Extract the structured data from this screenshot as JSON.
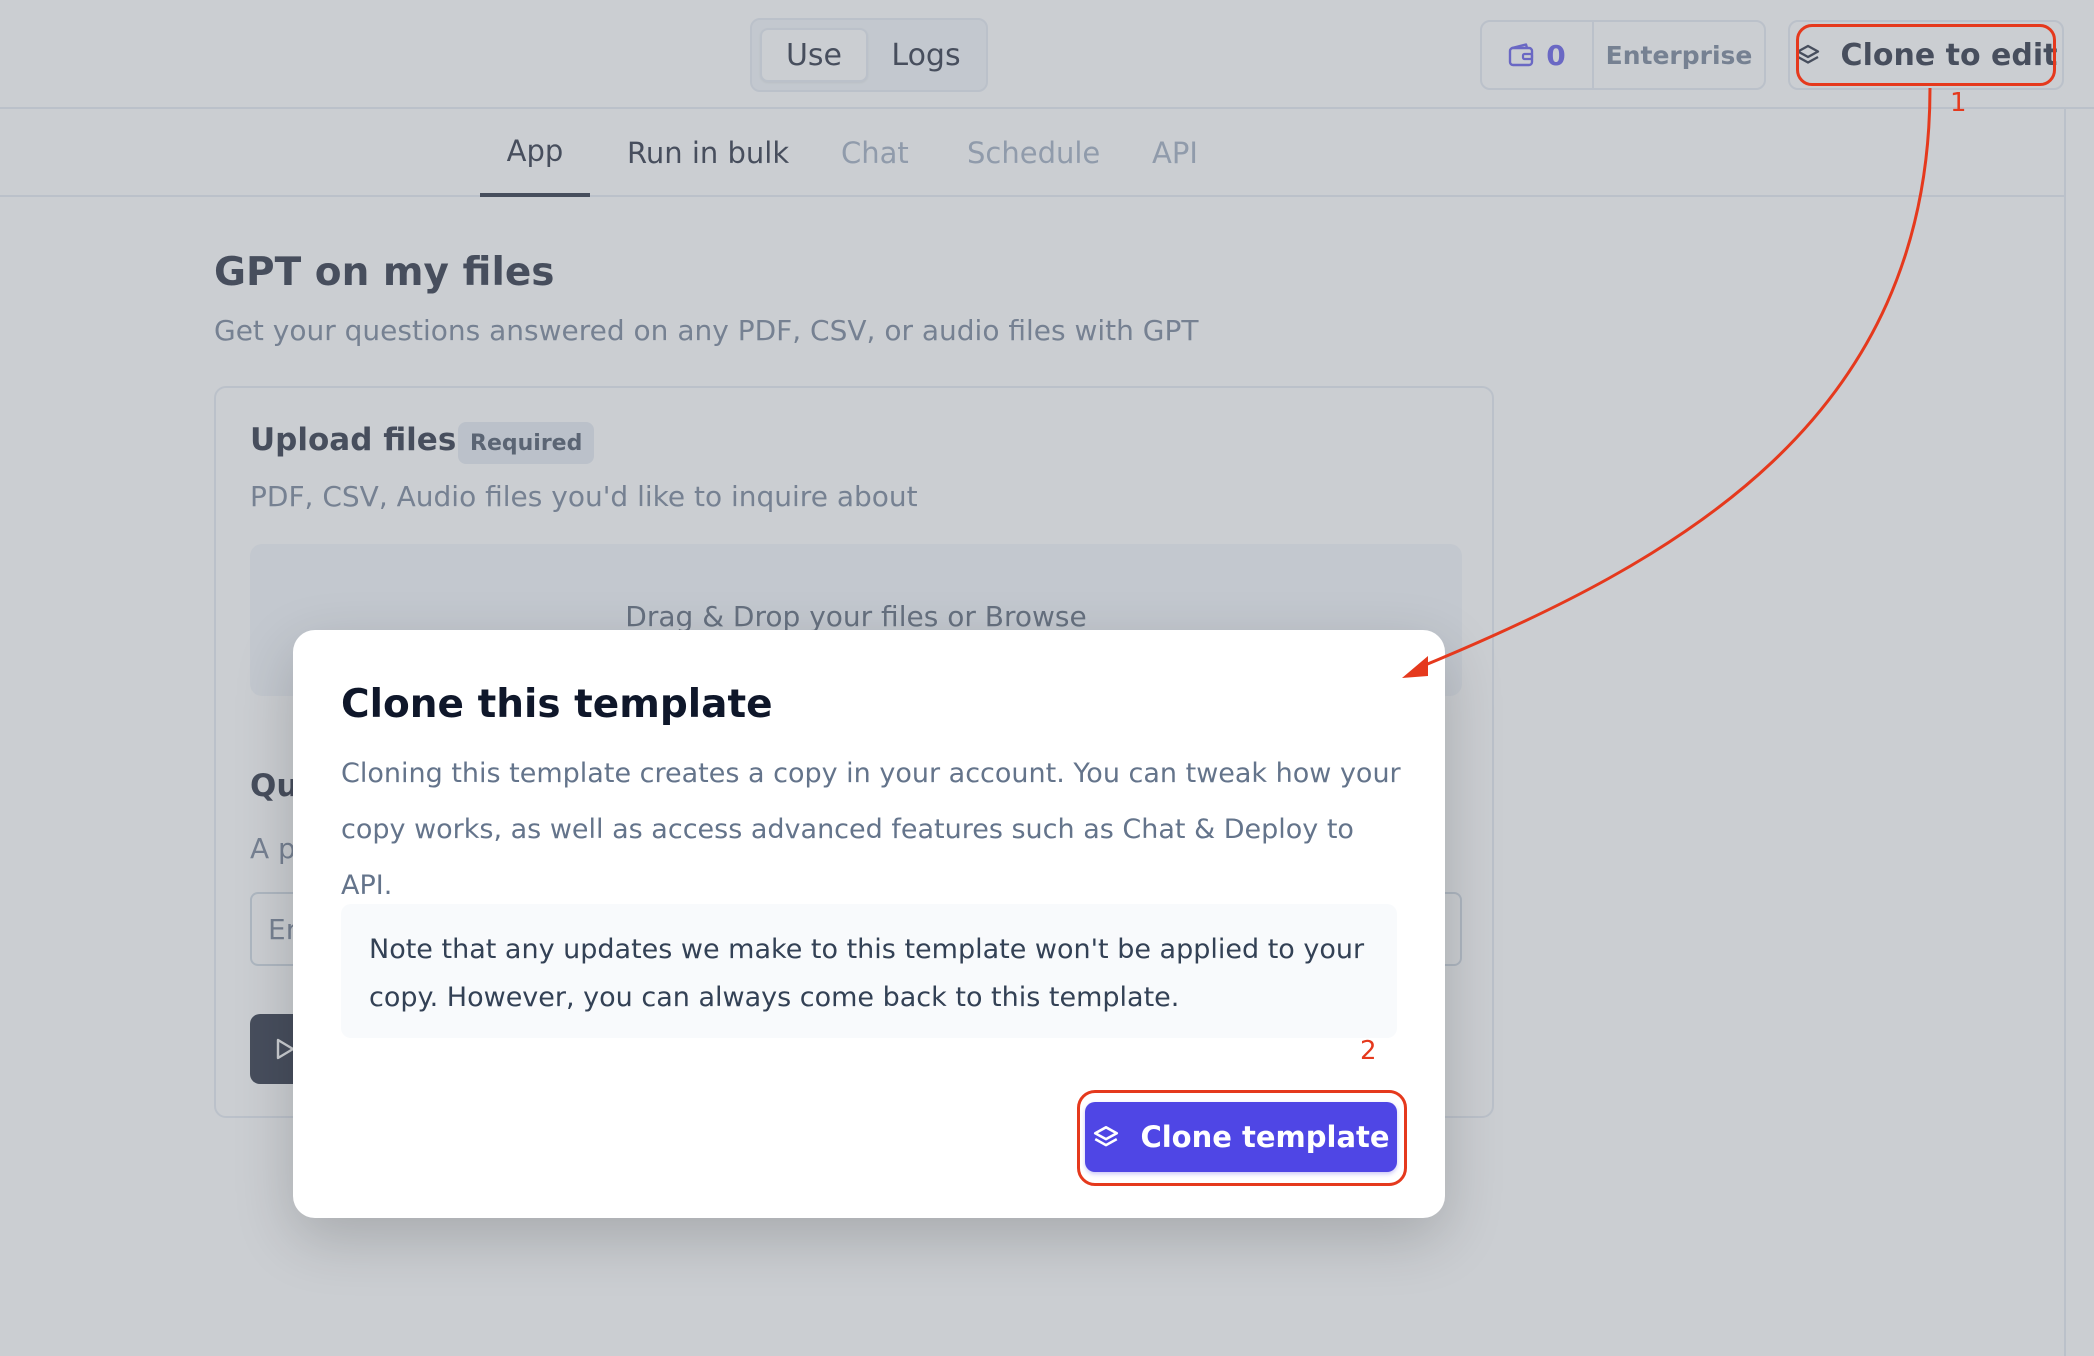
{
  "topbar": {
    "mode_tabs": [
      {
        "label": "Use",
        "active": true
      },
      {
        "label": "Logs",
        "active": false
      }
    ],
    "credits_count": "0",
    "plan_label": "Enterprise",
    "clone_to_edit_label": "Clone to edit"
  },
  "tabs": [
    {
      "label": "App",
      "active": true
    },
    {
      "label": "Run in bulk",
      "active": false
    },
    {
      "label": "Chat",
      "active": false
    },
    {
      "label": "Schedule",
      "active": false
    },
    {
      "label": "API",
      "active": false
    }
  ],
  "app": {
    "title": "GPT on my files",
    "description": "Get your questions answered on any PDF, CSV, or audio files with GPT",
    "upload": {
      "title": "Upload files",
      "badge": "Required",
      "description": "PDF, CSV, Audio files you'd like to inquire about",
      "dropzone_text": "Drag & Drop your files or Browse"
    },
    "question": {
      "title_partial": "Qu",
      "description_partial": "A p",
      "input_partial": "En"
    }
  },
  "modal": {
    "title": "Clone this template",
    "description": "Cloning this template creates a copy in your account. You can tweak how your copy works, as well as access advanced features such as Chat & Deploy to API.",
    "note": "Note that any updates we make to this template won't be applied to your copy. However, you can always come back to this template.",
    "clone_button_label": "Clone template"
  },
  "annotations": {
    "marker_1": "1",
    "marker_2": "2",
    "color": "#e5391d"
  },
  "colors": {
    "accent": "#4f46e5",
    "text_dark": "#0f172a",
    "text_muted": "#64748b"
  }
}
